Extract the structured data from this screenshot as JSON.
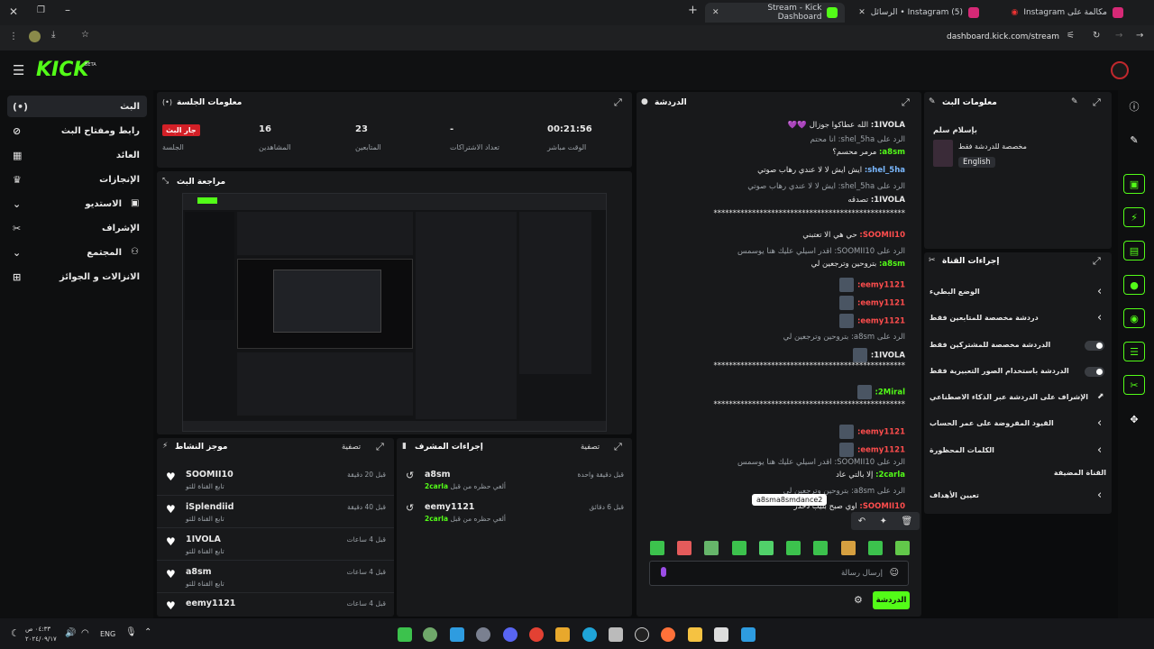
{
  "browser": {
    "tabs": [
      {
        "title": "Stream - Kick Dashboard",
        "active": true
      },
      {
        "title": "(5) Instagram • الرسائل"
      },
      {
        "title": "مكالمة على Instagram"
      }
    ],
    "url": "dashboard.kick.com/stream"
  },
  "header": {
    "logo": "KICK",
    "beta": "BETA"
  },
  "nav": [
    {
      "label": "البث",
      "icon": "(•)"
    },
    {
      "label": "رابط ومفتاح البث",
      "icon": "⊘"
    },
    {
      "label": "العائد",
      "icon": "▦"
    },
    {
      "label": "الإنجازات",
      "icon": "♛"
    },
    {
      "label": "الاستديو",
      "icon": "▣"
    },
    {
      "label": "الإشراف",
      "icon": "✂"
    },
    {
      "label": "المجتمع",
      "icon": "⚇"
    },
    {
      "label": "الانزالات و الجوائز",
      "icon": "⊞"
    }
  ],
  "session": {
    "title": "معلومات الجلسة",
    "stats": [
      {
        "value": "00:21:56",
        "label": "الوقت مباشر"
      },
      {
        "value": "-",
        "label": "تعداد الاشتراكات"
      },
      {
        "value": "23",
        "label": "المتابعين"
      },
      {
        "value": "16",
        "label": "المشاهدين"
      },
      {
        "value": "جار البث",
        "label": "الجلسة"
      }
    ]
  },
  "preview": {
    "title": "مراجعة البث"
  },
  "activity": {
    "title": "موجز النشاط",
    "filter": "تصفية",
    "items": [
      {
        "name": "SOOMII10",
        "sub": "تابع القناة للتو",
        "time": "قبل 20 دقيقة"
      },
      {
        "name": "iSplendiid",
        "sub": "تابع القناة للتو",
        "time": "قبل 40 دقيقة"
      },
      {
        "name": "1IVOLA",
        "sub": "تابع القناة للتو",
        "time": "قبل 4 ساعات"
      },
      {
        "name": "a8sm",
        "sub": "تابع القناة للتو",
        "time": "قبل 4 ساعات"
      },
      {
        "name": "eemy1121",
        "sub": "تابع القناة للتو",
        "time": "قبل 4 ساعات"
      }
    ]
  },
  "modactions": {
    "title": "إجراءات المشرف",
    "filter": "تصفية",
    "items": [
      {
        "name": "a8sm",
        "sub": "ألغي حظره من قبل",
        "by": "2carla",
        "time": "قبل دقيقة واحدة"
      },
      {
        "name": "eemy1121",
        "sub": "ألغي حظره من قبل",
        "by": "2carla",
        "time": "قبل 6 دقائق"
      }
    ]
  },
  "chat": {
    "title": "الدردشة",
    "placeholder": "إرسال رسالة",
    "send": "الدردشة",
    "tooltip": "a8sma8smdance2",
    "lines": [
      {
        "u": "1IVOLA:",
        "c": "#e9e9e9",
        "t": "الله عطاكوا جوزال 💜💜"
      },
      {
        "u": "",
        "c": "#9aa0a6",
        "t": "الرد على shel_5ha: انا محتم"
      },
      {
        "u": "a8sm:",
        "c": "#53fc18",
        "t": "مرمر محسم؟"
      },
      {
        "u": "shel_5ha:",
        "c": "#7ab8ff",
        "t": "ايش ايش لا لا عندي رهاب صوتي"
      },
      {
        "u": "",
        "c": "#9aa0a6",
        "t": "الرد على shel_5ha: ايش لا لا عندي رهاب صوتي"
      },
      {
        "u": "1IVOLA:",
        "c": "#e9e9e9",
        "t": "تصدقه"
      },
      {
        "u": "",
        "c": "#e9e9e9",
        "t": "**************************************************"
      },
      {
        "u": "SOOMII10:",
        "c": "#ff4d4d",
        "t": "حي هي الا تعتبني"
      },
      {
        "u": "",
        "c": "#9aa0a6",
        "t": "الرد على SOOMII10: اقدر اسيلي عليك هنا يوسمس"
      },
      {
        "u": "a8sm:",
        "c": "#53fc18",
        "t": "بتروحين وترجعين لي"
      },
      {
        "u": "eemy1121:",
        "c": "#ff4d4d",
        "t": ""
      },
      {
        "u": "eemy1121:",
        "c": "#ff4d4d",
        "t": ""
      },
      {
        "u": "eemy1121:",
        "c": "#ff4d4d",
        "t": ""
      },
      {
        "u": "",
        "c": "#9aa0a6",
        "t": "الرد على a8sm: بتروحين وترجعين لي"
      },
      {
        "u": "1IVOLA:",
        "c": "#e9e9e9",
        "t": ""
      },
      {
        "u": "",
        "c": "#e9e9e9",
        "t": "**************************************************"
      },
      {
        "u": "2Miral:",
        "c": "#53fc18",
        "t": ""
      },
      {
        "u": "",
        "c": "#e9e9e9",
        "t": "**************************************************"
      },
      {
        "u": "eemy1121:",
        "c": "#ff4d4d",
        "t": ""
      },
      {
        "u": "eemy1121:",
        "c": "#ff4d4d",
        "t": ""
      },
      {
        "u": "",
        "c": "#9aa0a6",
        "t": "الرد على SOOMII10: اقدر اسيلي عليك هنا يوسمس"
      },
      {
        "u": "2carla:",
        "c": "#53fc18",
        "t": "إلا بالتي عاد"
      },
      {
        "u": "",
        "c": "#9aa0a6",
        "t": "الرد على a8sm: بتروحين وترجعين لي"
      },
      {
        "u": "SOOMII10:",
        "c": "#ff4d4d",
        "t": "اوي صبح بليب دحدر"
      }
    ]
  },
  "streaminfo": {
    "title": "معلومات البث",
    "stream_title": "بإسلام سلم",
    "category": "مخصصة للدردشة فقط",
    "lang": "English"
  },
  "channelactions": {
    "title": "إجراءات القناة",
    "items": [
      {
        "label": "الوضع البطيء",
        "type": "chev"
      },
      {
        "label": "دردشة مخصصة للمتابعين فقط",
        "type": "chev"
      },
      {
        "label": "الدردشة مخصصة للمشتركين فقط",
        "type": "toggle"
      },
      {
        "label": "الدردشة باستخدام الصور التعبيرية فقط",
        "type": "toggle"
      },
      {
        "label": "الإشراف على الدردشة عبر الذكاء الاصطناعي",
        "type": "ext"
      },
      {
        "label": "القيود المفروضة على عمر الحساب",
        "type": "chev"
      },
      {
        "label": "الكلمات المحظورة",
        "type": "chev"
      },
      {
        "label": "القناة المضيفة",
        "type": "none"
      },
      {
        "label": "تعيين الأهداف",
        "type": "chev"
      }
    ]
  },
  "taskbar": {
    "lang": "ENG",
    "time": "٠٤:٣٣ ص",
    "date": "٢٠٢٤/٠٩/١٧"
  }
}
